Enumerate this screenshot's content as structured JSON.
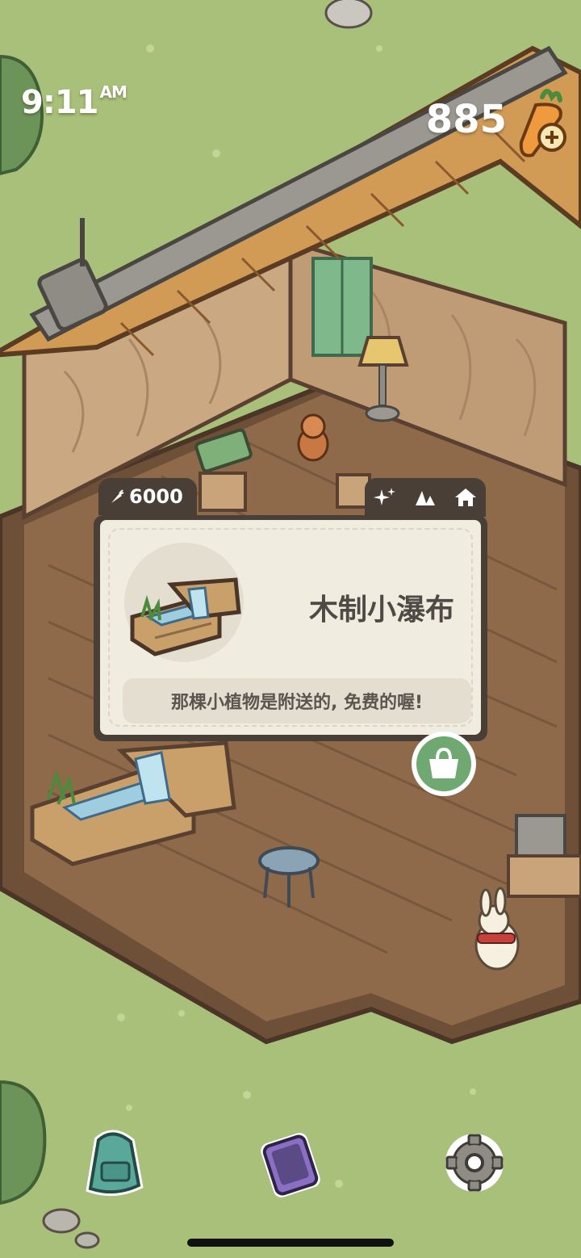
{
  "hud": {
    "time": "9:11",
    "time_suffix": "AM",
    "carrot_count": "885"
  },
  "item_card": {
    "price": "6000",
    "title": "木制小瀑布",
    "description": "那棵小植物是附送的, 免费的喔!",
    "tabs": [
      "sparkle-icon",
      "mountain-icon",
      "house-icon"
    ]
  },
  "bottom_bar": [
    "backpack-icon",
    "phone-icon",
    "gear-icon"
  ],
  "colors": {
    "grass": "#a9c07a",
    "card_frame": "#4a3f36",
    "card_bg": "#f1ece0",
    "bag_button": "#6fa870"
  }
}
